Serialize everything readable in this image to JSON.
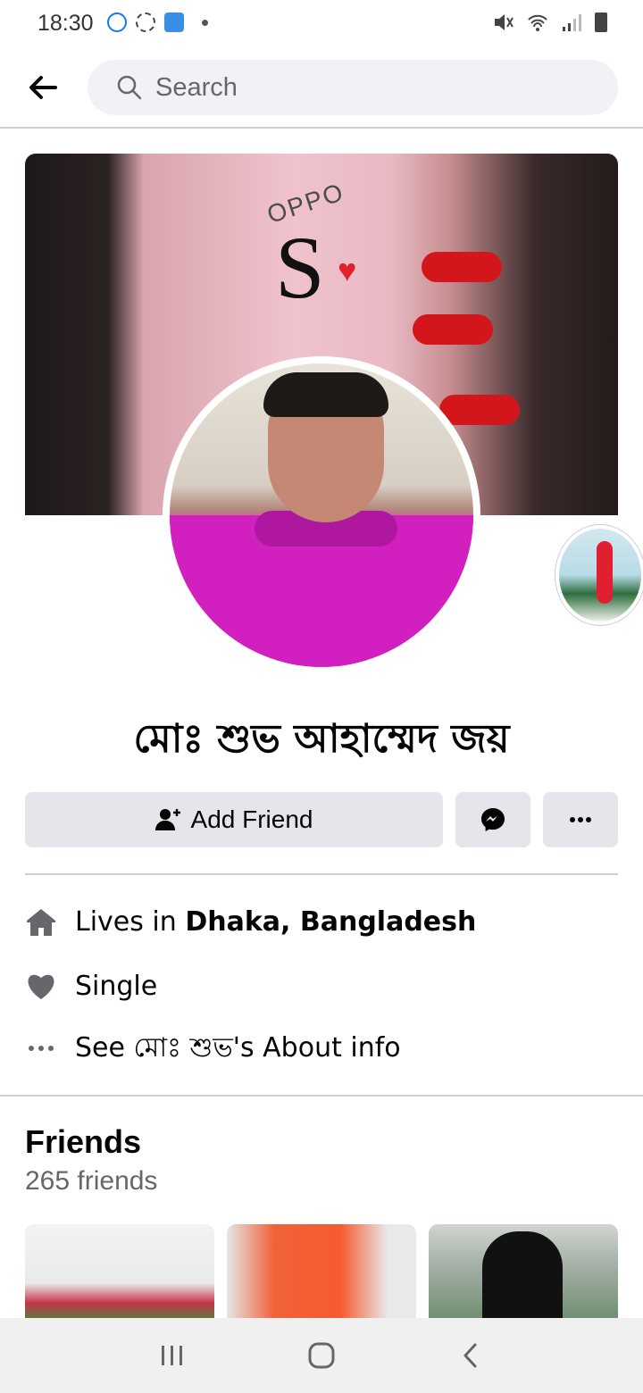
{
  "status_bar": {
    "time": "18:30"
  },
  "header": {
    "search_placeholder": "Search"
  },
  "profile": {
    "name": "মোঃ শুভ আহাম্মেদ জয়"
  },
  "actions": {
    "add_friend_label": "Add Friend"
  },
  "details": {
    "lives_in_prefix": "Lives in ",
    "lives_in_place": "Dhaka, Bangladesh",
    "relationship": "Single",
    "about_link": "See মোঃ শুভ's About info"
  },
  "friends": {
    "title": "Friends",
    "count": "265 friends"
  },
  "cover": {
    "logo_text": "OPPO",
    "letter": "S"
  },
  "colors": {
    "button_bg": "#e4e6eb",
    "search_bg": "#f0f2f5",
    "secondary_text": "#65676b",
    "icon_gray": "#65676b"
  }
}
